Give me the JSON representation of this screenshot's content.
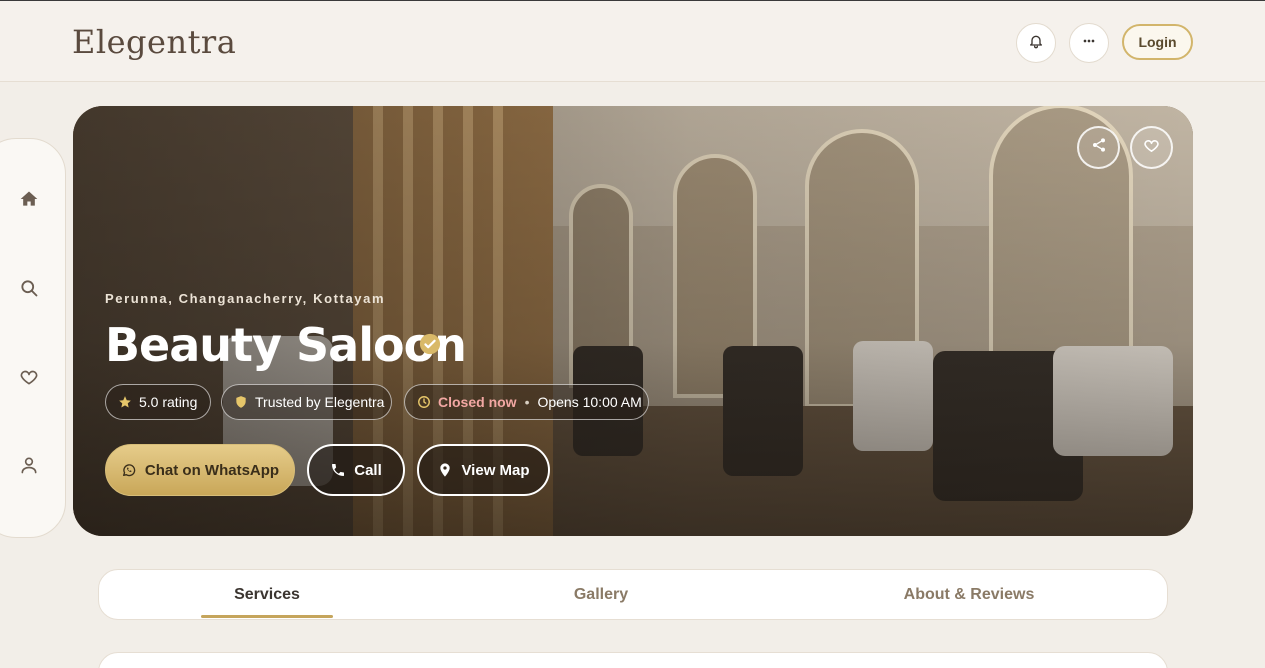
{
  "header": {
    "logo": "Elegentra",
    "login_label": "Login",
    "icons": {
      "notifications": "bell-icon",
      "more": "more-icon"
    }
  },
  "sidenav": {
    "items": [
      {
        "name": "home",
        "icon": "home-icon"
      },
      {
        "name": "search",
        "icon": "search-icon"
      },
      {
        "name": "favorites",
        "icon": "heart-icon"
      },
      {
        "name": "profile",
        "icon": "user-icon"
      }
    ]
  },
  "hero": {
    "location": "Perunna, Changanacherry, Kottayam",
    "title": "Beauty Saloon",
    "verified_icon": "verified-badge-icon",
    "rating_label": "5.0 rating",
    "trust_label": "Trusted by Elegentra",
    "status_label": "Closed now",
    "status_separator": "•",
    "hours_label": "Opens 10:00 AM",
    "whatsapp_label": "Chat on WhatsApp",
    "call_label": "Call",
    "map_label": "View Map"
  },
  "tabs": {
    "services": "Services",
    "gallery": "Gallery",
    "about": "About & Reviews",
    "active": "Services"
  },
  "colors": {
    "accent_gold": "#c5a55c",
    "status_closed": "#f2a7a3",
    "background": "#f2eee8"
  }
}
